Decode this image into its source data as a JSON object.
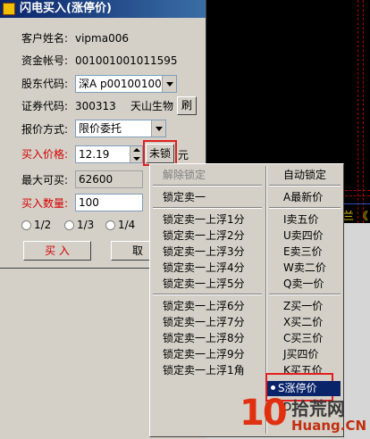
{
  "window": {
    "title": "闪电买入(涨停价)"
  },
  "form": {
    "customer_label": "客户姓名:",
    "customer_value": "vipma006",
    "account_label": "资金帐号:",
    "account_value": "001001001011595",
    "shareholder_label": "股东代码:",
    "shareholder_value": "深A p00100100201",
    "security_label": "证券代码:",
    "security_code": "300313",
    "security_name": "天山生物",
    "refresh_label": "刷",
    "quote_label": "报价方式:",
    "quote_value": "限价委托",
    "price_label": "买入价格:",
    "price_value": "12.19",
    "lock_button": "未锁",
    "price_unit": "元",
    "max_label": "最大可买:",
    "max_value": "62600",
    "qty_label": "买入数量:",
    "qty_value": "100",
    "radios": [
      "1/2",
      "1/3",
      "1/4"
    ],
    "buy_button": "买 入",
    "cancel_button": "取"
  },
  "menu": {
    "left": {
      "unlock": "解除锁定",
      "group1": [
        "锁定卖一"
      ],
      "group2": [
        "锁定卖一上浮1分",
        "锁定卖一上浮2分",
        "锁定卖一上浮3分",
        "锁定卖一上浮4分",
        "锁定卖一上浮5分"
      ],
      "group3": [
        "锁定卖一上浮6分",
        "锁定卖一上浮7分",
        "锁定卖一上浮8分",
        "锁定卖一上浮9分",
        "锁定卖一上浮1角"
      ]
    },
    "right": {
      "auto": "自动锁定",
      "group1": [
        "A最新价"
      ],
      "group2": [
        "I卖五价",
        "U卖四价",
        "E卖三价",
        "W卖二价",
        "Q卖一价"
      ],
      "group3": [
        "Z买一价",
        "X买二价",
        "C买三价",
        "J买四价",
        "K买五价"
      ],
      "selected": "S涨停价",
      "after": "D"
    }
  },
  "background": {
    "chart_corner_text": "兰 《"
  },
  "watermark": {
    "number": "10",
    "cn_text": "拾荒网",
    "url": "Huang.CN"
  },
  "colors": {
    "highlight": "#e02020",
    "selection": "#0a246a",
    "titlebar": "#0a246a"
  }
}
